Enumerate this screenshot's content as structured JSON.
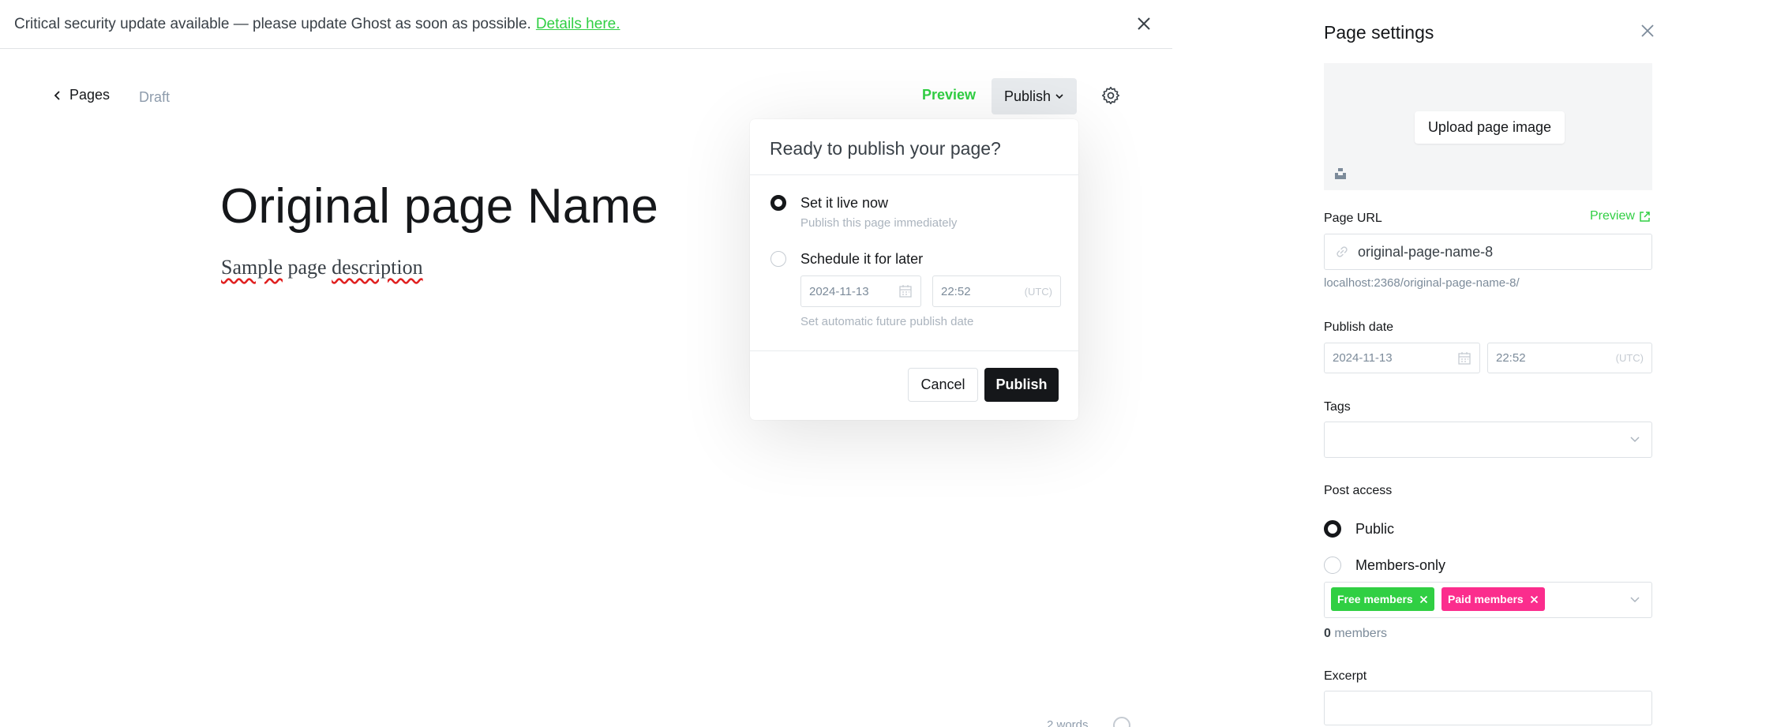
{
  "banner": {
    "message": "Critical security update available — please update Ghost as soon as possible.",
    "link": "Details here."
  },
  "editor": {
    "back_label": "Pages",
    "status": "Draft",
    "preview_label": "Preview",
    "publish_label": "Publish",
    "title": "Original page Name",
    "description_part1": "Sample",
    "description_part2": " page ",
    "description_part3": "description",
    "word_count": "2 words"
  },
  "publish_popover": {
    "heading": "Ready to publish your page?",
    "options": [
      {
        "title": "Set it live now",
        "subtitle": "Publish this page immediately",
        "selected": true
      },
      {
        "title": "Schedule it for later",
        "subtitle": "",
        "selected": false
      }
    ],
    "schedule_date": "2024-11-13",
    "schedule_time": "22:52",
    "timezone": "(UTC)",
    "schedule_hint": "Set automatic future publish date",
    "cancel_label": "Cancel",
    "publish_label": "Publish"
  },
  "settings_panel": {
    "title": "Page settings",
    "upload_label": "Upload page image",
    "url_label": "Page URL",
    "url_preview_label": "Preview",
    "url_slug": "original-page-name-8",
    "url_full": "localhost:2368/original-page-name-8/",
    "publish_date_label": "Publish date",
    "publish_date": "2024-11-13",
    "publish_time": "22:52",
    "timezone": "(UTC)",
    "tags_label": "Tags",
    "access_label": "Post access",
    "access_options": [
      "Public",
      "Members-only"
    ],
    "access_selected": "Public",
    "member_tags": [
      "Free members",
      "Paid members"
    ],
    "members_count_num": "0",
    "members_count_text": " members",
    "excerpt_label": "Excerpt"
  },
  "colors": {
    "accent_green": "#30cf43",
    "paid_pink": "#fb2d8d",
    "dark": "#15171a"
  }
}
